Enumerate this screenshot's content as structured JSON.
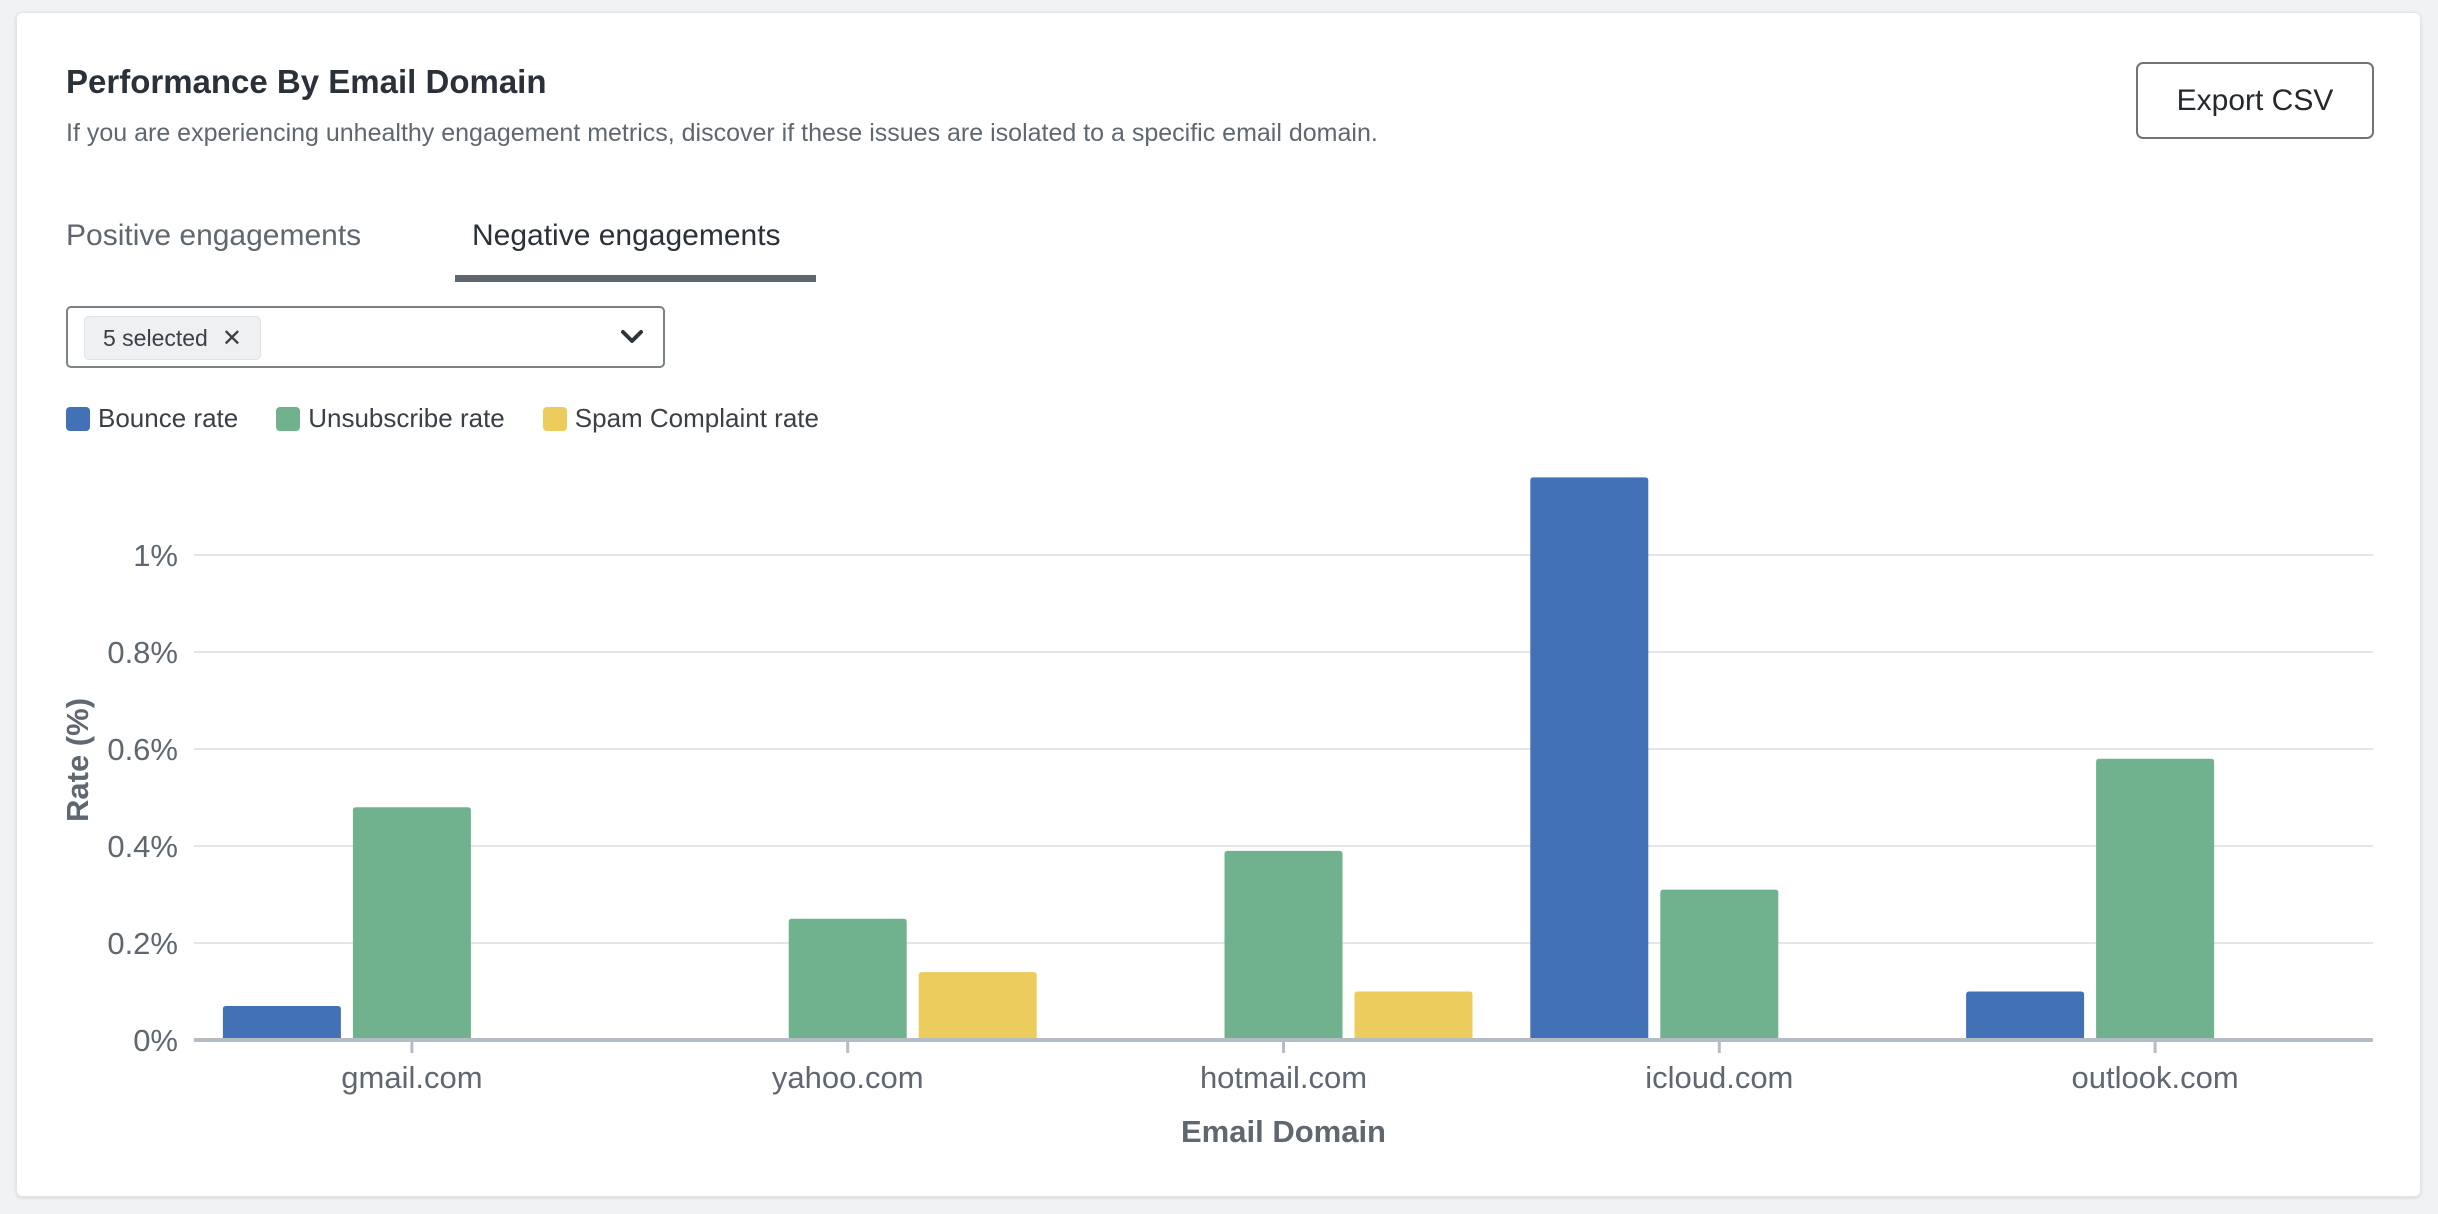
{
  "header": {
    "title": "Performance By Email Domain",
    "subtitle": "If you are experiencing unhealthy engagement metrics, discover if these issues are isolated to a specific email domain.",
    "export_label": "Export CSV"
  },
  "tabs": [
    {
      "label": "Positive engagements",
      "active": false
    },
    {
      "label": "Negative engagements",
      "active": true
    }
  ],
  "filter": {
    "chip_label": "5 selected",
    "clear_icon": "close-icon",
    "toggle_icon": "chevron-down-icon"
  },
  "colors": {
    "bounce": "#4371b5",
    "unsubscribe": "#70b28e",
    "spam": "#ebcc5d",
    "grid": "#e3e5e8",
    "axis": "#b6bcc4"
  },
  "chart_data": {
    "type": "bar",
    "title": "Performance By Email Domain",
    "xlabel": "Email Domain",
    "ylabel": "Rate (%)",
    "ylim": [
      0,
      1.2
    ],
    "yticks": [
      0,
      0.2,
      0.4,
      0.6,
      0.8,
      1.0
    ],
    "ytick_labels": [
      "0%",
      "0.2%",
      "0.4%",
      "0.6%",
      "0.8%",
      "1%"
    ],
    "grid": true,
    "legend_position": "top-left",
    "categories": [
      "gmail.com",
      "yahoo.com",
      "hotmail.com",
      "icloud.com",
      "outlook.com"
    ],
    "series": [
      {
        "name": "Bounce rate",
        "color_key": "bounce",
        "values": [
          0.07,
          0,
          0,
          1.16,
          0.1
        ]
      },
      {
        "name": "Unsubscribe rate",
        "color_key": "unsubscribe",
        "values": [
          0.48,
          0.25,
          0.39,
          0.31,
          0.58
        ]
      },
      {
        "name": "Spam Complaint rate",
        "color_key": "spam",
        "values": [
          0,
          0.14,
          0,
          0,
          0
        ]
      }
    ],
    "spam_extra_values": {
      "hotmail.com": 0.1
    }
  }
}
